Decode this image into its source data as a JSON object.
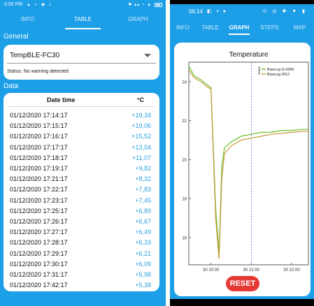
{
  "left": {
    "status_bar": {
      "time": "5:55 PM",
      "left_icons": "▲ ◐ ◉ ⌂",
      "right_icons": "✱ ▴▴ ◔ ▲"
    },
    "tabs": [
      {
        "label": "INFO",
        "active": false
      },
      {
        "label": "TABLE",
        "active": true
      },
      {
        "label": "GRAPH",
        "active": false
      }
    ],
    "general_label": "General",
    "device": {
      "selected": "TempBLE-FC30",
      "status": "Status:  No warning detected"
    },
    "data_label": "Data",
    "table": {
      "headers": [
        "Date time",
        "°C"
      ],
      "rows": [
        {
          "datetime": "01/12/2020 17:14:17",
          "value": "+19,34"
        },
        {
          "datetime": "01/12/2020 17:15:17",
          "value": "+19,06"
        },
        {
          "datetime": "01/12/2020 17:16:17",
          "value": "+15,52"
        },
        {
          "datetime": "01/12/2020 17:17:17",
          "value": "+13,04"
        },
        {
          "datetime": "01/12/2020 17:18:17",
          "value": "+11,07"
        },
        {
          "datetime": "01/12/2020 17:19:17",
          "value": "+9,82"
        },
        {
          "datetime": "01/12/2020 17:21:17",
          "value": "+8,32"
        },
        {
          "datetime": "01/12/2020 17:22:17",
          "value": "+7,83"
        },
        {
          "datetime": "01/12/2020 17:23:17",
          "value": "+7,45"
        },
        {
          "datetime": "01/12/2020 17:25:17",
          "value": "+6,89"
        },
        {
          "datetime": "01/12/2020 17:26:17",
          "value": "+6,67"
        },
        {
          "datetime": "01/12/2020 17:27:17",
          "value": "+6,49"
        },
        {
          "datetime": "01/12/2020 17:28:17",
          "value": "+6,33"
        },
        {
          "datetime": "01/12/2020 17:29:17",
          "value": "+6,21"
        },
        {
          "datetime": "01/12/2020 17:30:17",
          "value": "+6,09"
        },
        {
          "datetime": "01/12/2020 17:31:17",
          "value": "+5,98"
        },
        {
          "datetime": "01/12/2020 17:42:17",
          "value": "+5,38"
        }
      ]
    }
  },
  "right": {
    "status_bar": {
      "time": "06:14",
      "left_icons": "◧ ◑ ●",
      "right_icons": "⊙ ◎ ✱ ▼ ▮"
    },
    "tabs": [
      {
        "label": "INFO",
        "active": false
      },
      {
        "label": "TABLE",
        "active": false
      },
      {
        "label": "GRAPH",
        "active": true
      },
      {
        "label": "STEPS",
        "active": false
      },
      {
        "label": "MAP",
        "active": false
      }
    ],
    "reset_label": "RESET"
  },
  "chart_data": {
    "type": "line",
    "title": "Temperature",
    "xlabel": "",
    "ylabel": "",
    "x_tick_labels": [
      "30 20:00",
      "30 21:00",
      "30 22:00"
    ],
    "y_ticks": [
      16,
      18,
      20,
      22,
      24
    ],
    "ylim": [
      14.6,
      25.0
    ],
    "legend_title": "Name",
    "legend_position": "top-right",
    "marker_line_label": "30 21:00",
    "series": [
      {
        "name": "BlueLog G-03A9",
        "color": "#6cbf2a",
        "x": [
          "30 19:27",
          "30 19:35",
          "30 19:45",
          "30 19:52",
          "30 20:00",
          "30 20:07",
          "30 20:12",
          "30 20:16",
          "30 20:20",
          "30 20:30",
          "30 20:45",
          "30 21:00",
          "30 21:15",
          "30 21:30",
          "30 21:45",
          "30 22:00",
          "30 22:15",
          "30 22:25"
        ],
        "y": [
          24.8,
          24.3,
          24.1,
          23.9,
          23.7,
          17.5,
          15.2,
          19.6,
          20.6,
          20.9,
          21.2,
          21.3,
          21.4,
          21.4,
          21.5,
          21.5,
          21.55,
          21.55
        ]
      },
      {
        "name": "BlueLog 0012",
        "color": "#c69a3a",
        "x": [
          "30 19:27",
          "30 19:35",
          "30 19:45",
          "30 19:52",
          "30 20:00",
          "30 20:07",
          "30 20:12",
          "30 20:16",
          "30 20:20",
          "30 20:30",
          "30 20:45",
          "30 21:00",
          "30 21:15",
          "30 21:30",
          "30 21:45",
          "30 22:00",
          "30 22:15",
          "30 22:25"
        ],
        "y": [
          24.6,
          24.2,
          24.0,
          23.8,
          23.6,
          17.0,
          14.9,
          19.0,
          20.3,
          20.7,
          21.0,
          21.1,
          21.2,
          21.3,
          21.35,
          21.4,
          21.45,
          21.45
        ]
      }
    ]
  },
  "colors": {
    "app_blue": "#1d9fe8",
    "value_blue": "#2a9fdf",
    "reset_red": "#e53935",
    "marker_line": "#5b6cc6"
  }
}
